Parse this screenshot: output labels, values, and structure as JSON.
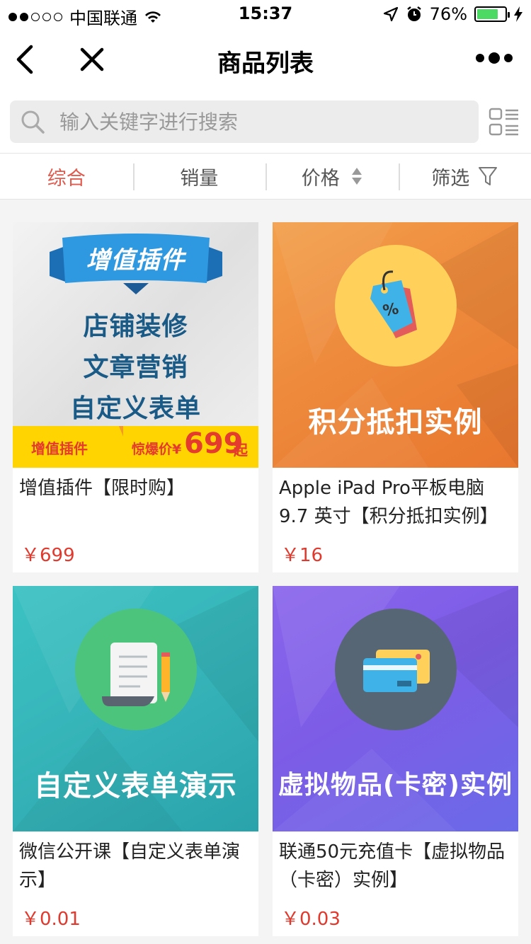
{
  "status": {
    "carrier": "中国联通",
    "time": "15:37",
    "battery": "76%"
  },
  "nav": {
    "title": "商品列表"
  },
  "search": {
    "placeholder": "输入关键字进行搜索"
  },
  "filters": [
    {
      "label": "综合"
    },
    {
      "label": "销量"
    },
    {
      "label": "价格"
    },
    {
      "label": "筛选"
    }
  ],
  "products": [
    {
      "title": "增值插件【限时购】",
      "price": "￥699",
      "banner_ribbon": "增值插件",
      "banner_lines": [
        "店铺装修",
        "文章营销",
        "自定义表单"
      ],
      "banner_footer_left": "增值插件",
      "banner_footer_right_label": "惊爆价¥",
      "banner_footer_price": "699",
      "banner_footer_suffix": "起"
    },
    {
      "title": "Apple iPad Pro平板电脑9.7 英寸【积分抵扣实例】",
      "price": "￥16",
      "banner_text": "积分抵扣实例",
      "tag_text": "%"
    },
    {
      "title": "微信公开课【自定义表单演示】",
      "price": "￥0.01",
      "banner_text": "自定义表单演示"
    },
    {
      "title": "联通50元充值卡【虚拟物品（卡密）实例】",
      "price": "￥0.03",
      "banner_text": "虚拟物品(卡密)实例"
    }
  ],
  "colors": {
    "accent_red": "#e05a4e",
    "price_red": "#e03a2e",
    "orange": "#ee8a3c",
    "teal": "#36b5b9",
    "purple": "#7d5ce6"
  }
}
